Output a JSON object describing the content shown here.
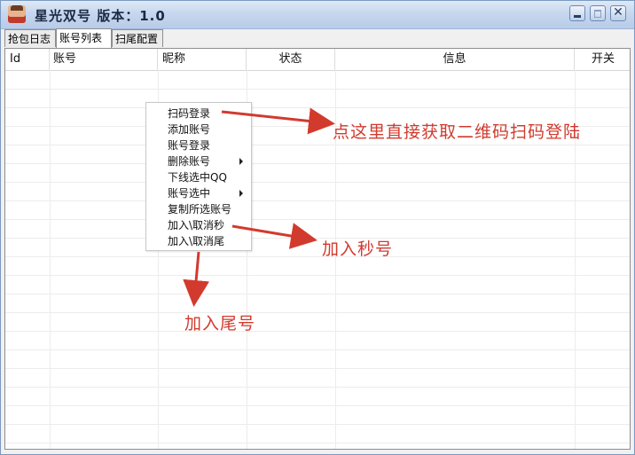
{
  "window": {
    "title": "星光双号  版本：1.0",
    "controls": {
      "minimize_icon": "minimize-icon",
      "maximize_icon": "maximize-icon",
      "close_icon": "close-icon",
      "close_glyph": "✕"
    }
  },
  "tabs": [
    {
      "label": "抢包日志",
      "active": false
    },
    {
      "label": "账号列表",
      "active": true
    },
    {
      "label": "扫尾配置",
      "active": false
    }
  ],
  "table": {
    "columns": [
      "Id",
      "账号",
      "昵称",
      "状态",
      "信息",
      "开关"
    ],
    "rows": []
  },
  "context_menu": {
    "items": [
      {
        "label": "扫码登录",
        "has_submenu": false
      },
      {
        "label": "添加账号",
        "has_submenu": false
      },
      {
        "label": "账号登录",
        "has_submenu": false
      },
      {
        "label": "删除账号",
        "has_submenu": true
      },
      {
        "label": "下线选中QQ",
        "has_submenu": false
      },
      {
        "label": "账号选中",
        "has_submenu": true
      },
      {
        "label": "复制所选账号",
        "has_submenu": false
      },
      {
        "label": "加入\\取消秒",
        "has_submenu": false
      },
      {
        "label": "加入\\取消尾",
        "has_submenu": false
      }
    ]
  },
  "annotations": {
    "scan_login": "点这里直接获取二维码扫码登陆",
    "join_sec": "加入秒号",
    "join_tail": "加入尾号",
    "color": "#d23a2e"
  }
}
